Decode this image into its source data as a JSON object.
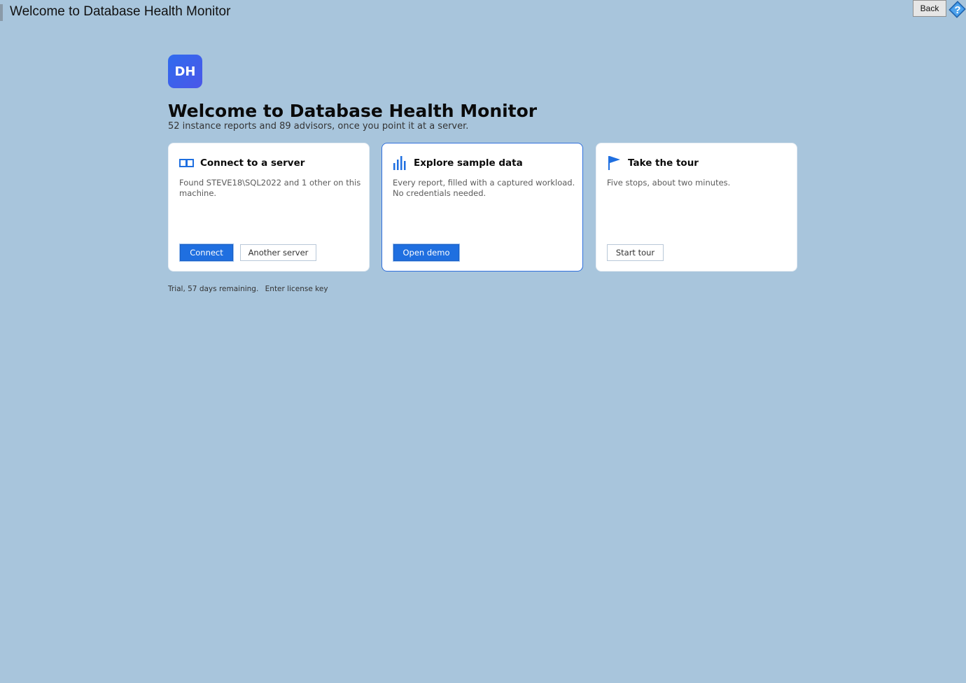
{
  "window": {
    "title": "Welcome to Database Health Monitor",
    "back_label": "Back",
    "help_icon": "help-question-icon"
  },
  "header": {
    "logo_text": "DH",
    "title": "Welcome to Database Health Monitor",
    "subtitle": "52 instance reports and 89 advisors, once you point it at a server."
  },
  "cards": [
    {
      "icon": "server-columns-icon",
      "title": "Connect to a server",
      "description": "Found STEVE18\\SQL2022 and 1 other on this machine.",
      "buttons": [
        {
          "label": "Connect",
          "style": "primary"
        },
        {
          "label": "Another server",
          "style": "secondary"
        }
      ]
    },
    {
      "icon": "bar-chart-icon",
      "title": "Explore sample data",
      "description": "Every report, filled with a captured workload. No credentials needed.",
      "buttons": [
        {
          "label": "Open demo",
          "style": "primary"
        }
      ]
    },
    {
      "icon": "flag-icon",
      "title": "Take the tour",
      "description": "Five stops, about two minutes.",
      "buttons": [
        {
          "label": "Start tour",
          "style": "secondary"
        }
      ]
    }
  ],
  "footer": {
    "trial_text": "Trial, 57 days remaining.",
    "license_link": "Enter license key"
  },
  "colors": {
    "background": "#a8c5dc",
    "accent": "#1f6fe0",
    "card_background": "#ffffff"
  }
}
